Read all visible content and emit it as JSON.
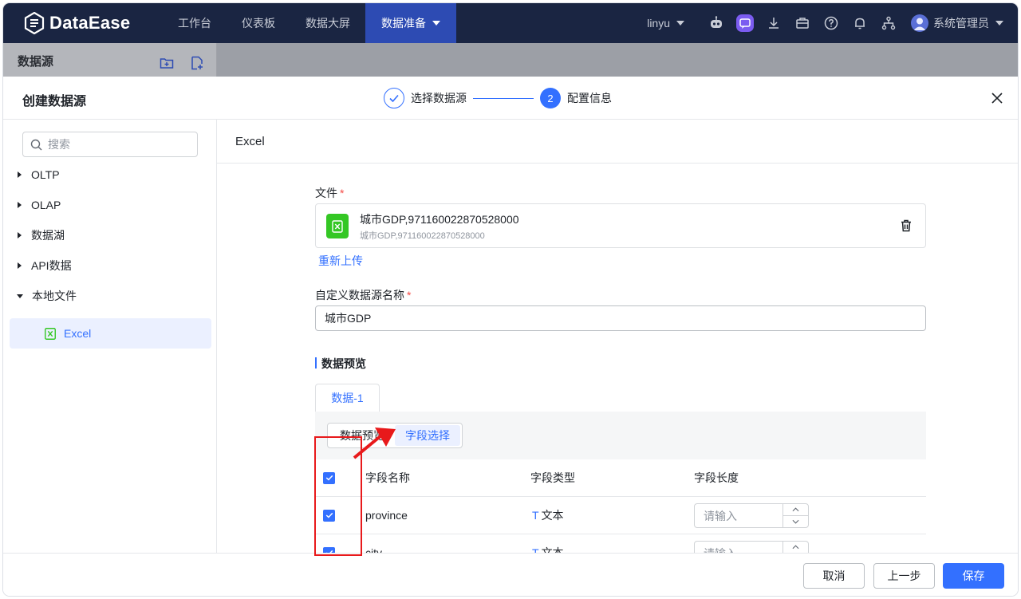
{
  "topbar": {
    "brand": "DataEase",
    "nav": [
      {
        "label": "工作台",
        "active": false
      },
      {
        "label": "仪表板",
        "active": false
      },
      {
        "label": "数据大屏",
        "active": false
      },
      {
        "label": "数据准备",
        "active": true
      }
    ],
    "user_short": "linyu",
    "admin_name": "系统管理员",
    "icons": [
      "robot-icon",
      "ai-chat-icon",
      "download-icon",
      "briefcase-icon",
      "help-icon",
      "bell-icon",
      "org-tree-icon"
    ]
  },
  "background": {
    "title": "数据源",
    "icons": [
      "new-folder-icon",
      "new-datasource-icon"
    ]
  },
  "dialog": {
    "title": "创建数据源",
    "steps": [
      {
        "label": "选择数据源",
        "state": "done"
      },
      {
        "number": "2",
        "label": "配置信息",
        "state": "current"
      }
    ],
    "search": {
      "placeholder": "搜索"
    },
    "tree": [
      {
        "label": "OLTP",
        "expanded": false
      },
      {
        "label": "OLAP",
        "expanded": false
      },
      {
        "label": "数据湖",
        "expanded": false
      },
      {
        "label": "API数据",
        "expanded": false
      },
      {
        "label": "本地文件",
        "expanded": true
      }
    ],
    "tree_selected": "Excel",
    "main": {
      "title": "Excel",
      "file_label": "文件",
      "file_name": "城市GDP,971160022870528000",
      "file_subname": "城市GDP,971160022870528000",
      "reupload": "重新上传",
      "name_label": "自定义数据源名称",
      "name_value": "城市GDP",
      "preview_title": "数据预览",
      "sheet_tab": "数据-1",
      "segments": [
        "数据预览",
        "字段选择"
      ],
      "active_segment": "字段选择",
      "table": {
        "headers": [
          "字段名称",
          "字段类型",
          "字段长度"
        ],
        "rows": [
          {
            "checked": true,
            "name": "province",
            "type_icon": "T",
            "type": "文本",
            "length_placeholder": "请输入"
          },
          {
            "checked": true,
            "name": "city",
            "type_icon": "T",
            "type": "文本",
            "length_placeholder": "请输入"
          }
        ]
      }
    },
    "footer": {
      "cancel": "取消",
      "prev": "上一步",
      "save": "保存"
    }
  },
  "colors": {
    "nav_bg": "#1a2542",
    "nav_active": "#2d4bb3",
    "accent": "#3370ff",
    "annotation": "#e8191b",
    "excel_green": "#34c724"
  }
}
